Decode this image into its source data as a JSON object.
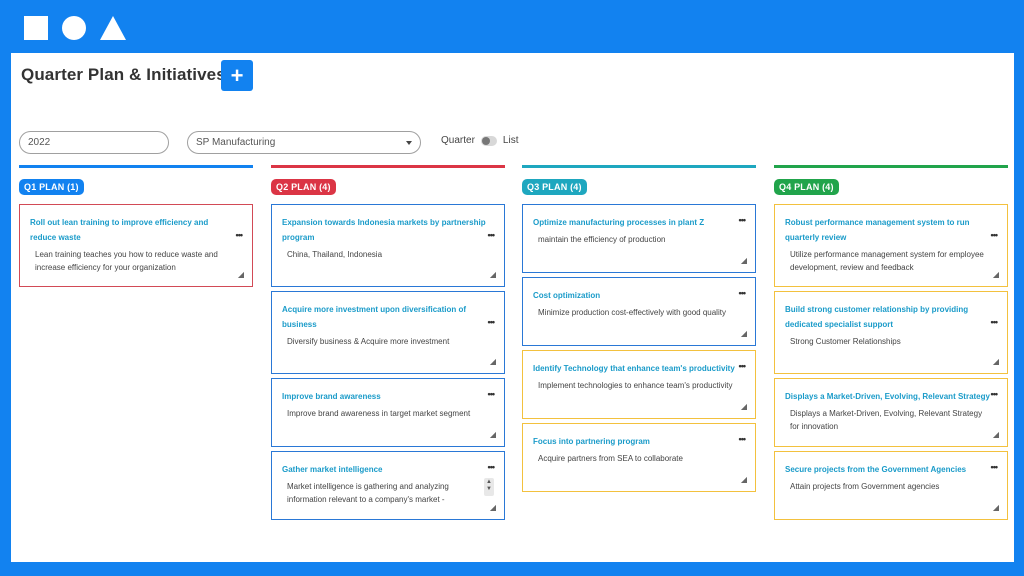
{
  "colors": {
    "brand": "#1282f0",
    "q1": "#1282f0",
    "q2": "#db3545",
    "q3": "#1ea7bf",
    "q4": "#21a44b",
    "card_red": "#d24a56",
    "card_blue": "#2a78d6",
    "card_yellow": "#f3c13e",
    "title_link": "#1a9bc9"
  },
  "logo": {
    "icons": [
      "square-icon",
      "circle-icon",
      "triangle-icon"
    ]
  },
  "header": {
    "title": "Quarter Plan & Initiatives",
    "add_label": "+"
  },
  "filters": {
    "year": "2022",
    "company": "SP Manufacturing",
    "toggle_left": "Quarter",
    "toggle_right": "List"
  },
  "columns": [
    {
      "label": "Q1 PLAN (1)",
      "cards": [
        {
          "title": "Roll out lean training to improve efficiency and reduce waste",
          "desc": "Lean training teaches you how to reduce waste and increase efficiency for your organization",
          "dots": "•••"
        }
      ]
    },
    {
      "label": "Q2 PLAN (4)",
      "cards": [
        {
          "title": "Expansion towards Indonesia markets by partnership program",
          "desc": "China, Thailand, Indonesia",
          "dots": "•••"
        },
        {
          "title": "Acquire more investment upon diversification of business",
          "desc": "Diversify business & Acquire more investment",
          "dots": "•••"
        },
        {
          "title": "Improve brand awareness",
          "desc": "Improve brand awareness in target market segment",
          "dots": "•••"
        },
        {
          "title": "Gather market intelligence",
          "desc": "Market intelligence is gathering and analyzing information relevant to a company's market -",
          "dots": "•••"
        }
      ]
    },
    {
      "label": "Q3 PLAN (4)",
      "cards": [
        {
          "title": "Optimize manufacturing processes in plant Z",
          "desc": "maintain the efficiency of production",
          "dots": "•••"
        },
        {
          "title": "Cost optimization",
          "desc": "Minimize production cost-effectively with good quality",
          "dots": "•••"
        },
        {
          "title": "Identify Technology that enhance team's productivity",
          "desc": "Implement technologies to enhance team's productivity",
          "dots": "•••"
        },
        {
          "title": "Focus into partnering program",
          "desc": "Acquire partners from SEA to collaborate",
          "dots": "•••"
        }
      ]
    },
    {
      "label": "Q4 PLAN (4)",
      "cards": [
        {
          "title": "Robust performance management system to run quarterly review",
          "desc": "Utilize performance management system for employee development, review and feedback",
          "dots": "•••"
        },
        {
          "title": "Build strong customer relationship by providing dedicated specialist support",
          "desc": "Strong Customer Relationships",
          "dots": "•••"
        },
        {
          "title": "Displays a Market-Driven, Evolving, Relevant Strategy",
          "desc": "Displays a Market-Driven, Evolving, Relevant Strategy for innovation",
          "dots": "•••"
        },
        {
          "title": "Secure projects from the Government Agencies",
          "desc": "Attain projects from Government agencies",
          "dots": "•••"
        }
      ]
    }
  ]
}
